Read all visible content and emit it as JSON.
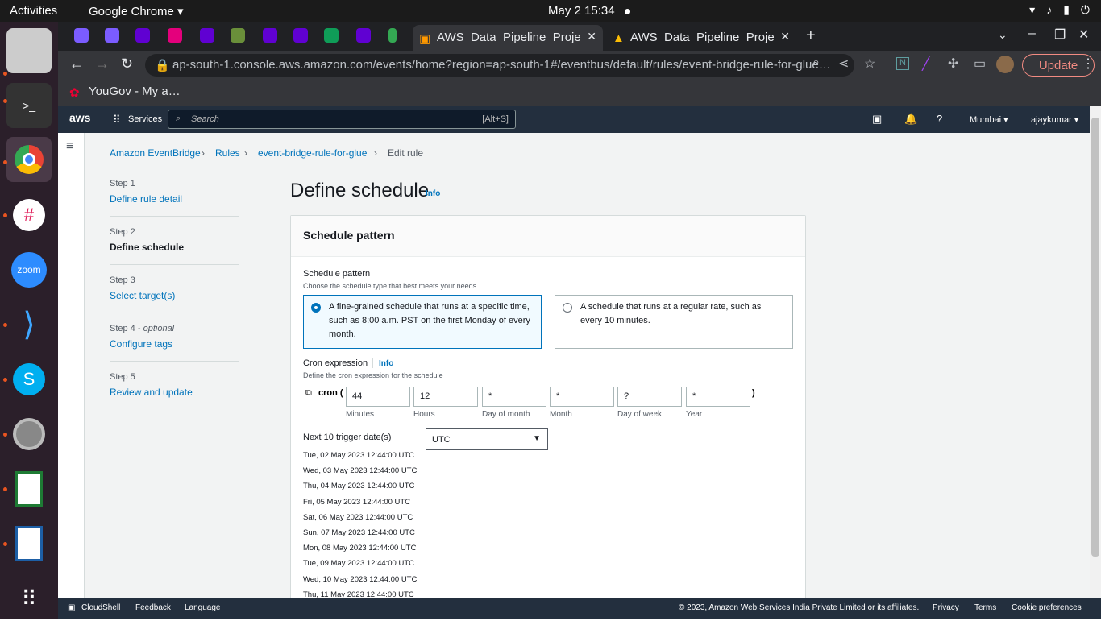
{
  "os": {
    "activities": "Activities",
    "app": "Google Chrome",
    "clock": "May 2  15:34"
  },
  "browser": {
    "tabs": [
      {
        "label": "AWS_Data_Pipeline_Proje"
      },
      {
        "label": "AWS_Data_Pipeline_Proje"
      }
    ],
    "url": "ap-south-1.console.aws.amazon.com/events/home?region=ap-south-1#/eventbus/default/rules/event-bridge-rule-for-glue…",
    "update": "Update",
    "bookmark": "YouGov - My a…"
  },
  "aws": {
    "logo": "aws",
    "services": "Services",
    "search_placeholder": "Search",
    "search_shortcut": "[Alt+S]",
    "region": "Mumbai",
    "user": "ajaykumar"
  },
  "breadcrumb": [
    "Amazon EventBridge",
    "Rules",
    "event-bridge-rule-for-glue",
    "Edit rule"
  ],
  "steps": [
    {
      "num": "Step 1",
      "label": "Define rule detail"
    },
    {
      "num": "Step 2",
      "label": "Define schedule"
    },
    {
      "num": "Step 3",
      "label": "Select target(s)"
    },
    {
      "num": "Step 4",
      "opt": "optional",
      "label": "Configure tags"
    },
    {
      "num": "Step 5",
      "label": "Review and update"
    }
  ],
  "page": {
    "title": "Define schedule",
    "info": "Info"
  },
  "card": {
    "header": "Schedule pattern",
    "pattern_label": "Schedule pattern",
    "pattern_desc": "Choose the schedule type that best meets your needs.",
    "opt1": "A fine-grained schedule that runs at a specific time, such as 8:00 a.m. PST on the first Monday of every month.",
    "opt2": "A schedule that runs at a regular rate, such as every 10 minutes.",
    "cron_label": "Cron expression",
    "cron_info": "Info",
    "cron_desc": "Define the cron expression for the schedule",
    "cron_prefix": "cron (",
    "cron_suffix": ")",
    "cron_fields": [
      {
        "value": "44",
        "label": "Minutes"
      },
      {
        "value": "12",
        "label": "Hours"
      },
      {
        "value": "*",
        "label": "Day of month"
      },
      {
        "value": "*",
        "label": "Month"
      },
      {
        "value": "?",
        "label": "Day of week"
      },
      {
        "value": "*",
        "label": "Year"
      }
    ],
    "next_label": "Next 10 trigger date(s)",
    "timezone": "UTC",
    "dates": [
      "Tue, 02 May 2023 12:44:00 UTC",
      "Wed, 03 May 2023 12:44:00 UTC",
      "Thu, 04 May 2023 12:44:00 UTC",
      "Fri, 05 May 2023 12:44:00 UTC",
      "Sat, 06 May 2023 12:44:00 UTC",
      "Sun, 07 May 2023 12:44:00 UTC",
      "Mon, 08 May 2023 12:44:00 UTC",
      "Tue, 09 May 2023 12:44:00 UTC",
      "Wed, 10 May 2023 12:44:00 UTC",
      "Thu, 11 May 2023 12:44:00 UTC"
    ]
  },
  "footer": {
    "cloudshell": "CloudShell",
    "feedback": "Feedback",
    "language": "Language",
    "copyright": "© 2023, Amazon Web Services India Private Limited or its affiliates.",
    "privacy": "Privacy",
    "terms": "Terms",
    "cookies": "Cookie preferences"
  }
}
